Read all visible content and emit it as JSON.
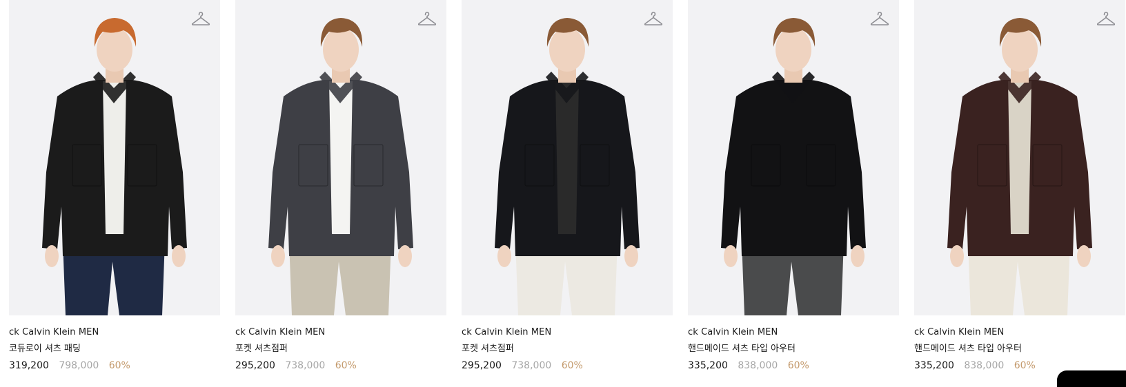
{
  "products": [
    {
      "brand": "ck Calvin Klein MEN",
      "name": "코듀로이 셔츠 패딩",
      "price": "319,200",
      "original_price": "798,000",
      "discount": "60%",
      "hanger_icon": "hanger-icon",
      "colors": {
        "jacket": "#1b1b1b",
        "inner": "#eeeeea",
        "pants": "#1f2a44",
        "hair": "#c86a2f"
      }
    },
    {
      "brand": "ck Calvin Klein MEN",
      "name": "포켓 셔츠점퍼",
      "price": "295,200",
      "original_price": "738,000",
      "discount": "60%",
      "hanger_icon": "hanger-icon",
      "colors": {
        "jacket": "#3e3f45",
        "inner": "#f4f4f2",
        "pants": "#c9c2b2",
        "hair": "#8a5a36"
      }
    },
    {
      "brand": "ck Calvin Klein MEN",
      "name": "포켓 셔츠점퍼",
      "price": "295,200",
      "original_price": "738,000",
      "discount": "60%",
      "hanger_icon": "hanger-icon",
      "colors": {
        "jacket": "#16171b",
        "inner": "#2a2a2a",
        "pants": "#ece9e2",
        "hair": "#8a5a36"
      }
    },
    {
      "brand": "ck Calvin Klein MEN",
      "name": "핸드메이드 셔츠 타입 아우터",
      "price": "335,200",
      "original_price": "838,000",
      "discount": "60%",
      "hanger_icon": "hanger-icon",
      "colors": {
        "jacket": "#121214",
        "inner": "#121214",
        "pants": "#4a4b4c",
        "hair": "#8a5a36"
      }
    },
    {
      "brand": "ck Calvin Klein MEN",
      "name": "핸드메이드 셔츠 타입 아우터",
      "price": "335,200",
      "original_price": "838,000",
      "discount": "60%",
      "hanger_icon": "hanger-icon",
      "colors": {
        "jacket": "#3a2220",
        "inner": "#d9d3c6",
        "pants": "#ebe6db",
        "hair": "#8a5a36"
      }
    }
  ]
}
